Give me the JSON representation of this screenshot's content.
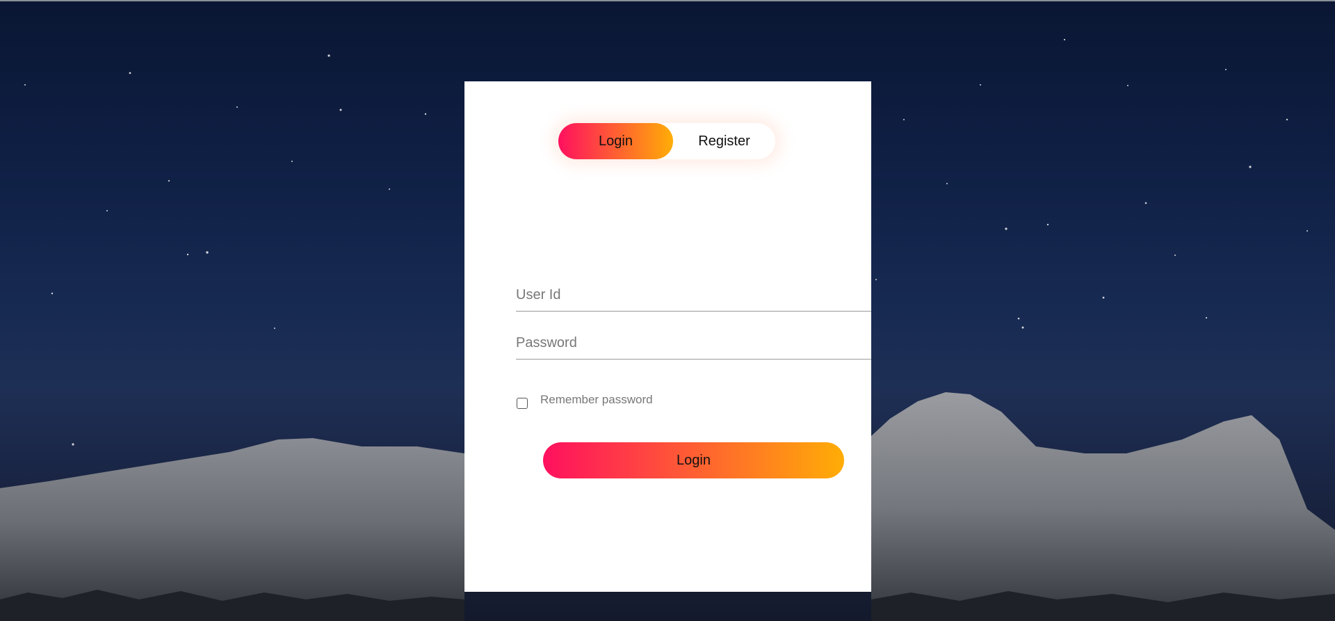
{
  "toggle": {
    "login_label": "Login",
    "register_label": "Register",
    "active": "login"
  },
  "login_form": {
    "userid_placeholder": "User Id",
    "password_placeholder": "Password",
    "remember_label": "Remember password",
    "remember_checked": false,
    "submit_label": "Login"
  },
  "colors": {
    "gradient_start": "#ff105f",
    "gradient_end": "#ffad06",
    "card_background": "#ffffff"
  }
}
